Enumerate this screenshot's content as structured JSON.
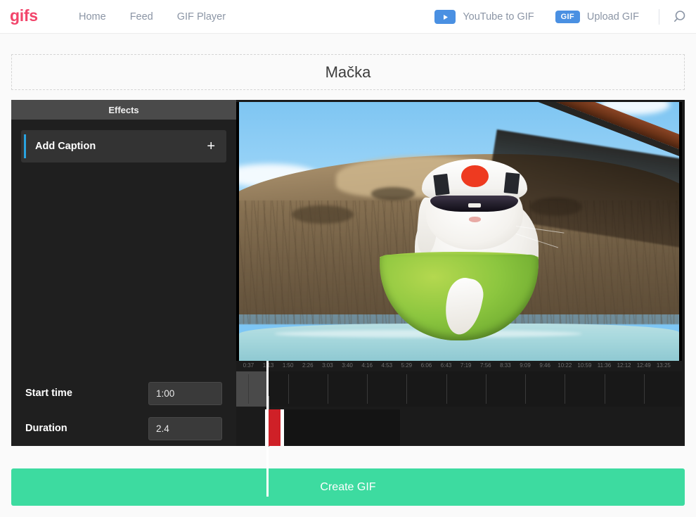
{
  "header": {
    "brand": "gifs",
    "nav": [
      {
        "label": "Home"
      },
      {
        "label": "Feed"
      },
      {
        "label": "GIF Player"
      }
    ],
    "youtube_to_gif": "YouTube to GIF",
    "gif_badge": "GIF",
    "upload_gif": "Upload GIF",
    "search_icon": "search-icon",
    "play_icon": "play-triangle-icon",
    "brand_color": "#f2456b",
    "accent_blue": "#4a90e2"
  },
  "title": {
    "text": "Mačka"
  },
  "effects": {
    "header": "Effects",
    "items": [
      {
        "label": "Add Caption",
        "add_icon": "plus-icon",
        "accent_color": "#29a3e0"
      }
    ]
  },
  "form": {
    "start_time": {
      "label": "Start time",
      "value": "1:00",
      "placeholder": "0:00"
    },
    "duration": {
      "label": "Duration",
      "value": "2.4",
      "placeholder": "0"
    }
  },
  "timeline": {
    "ticks": [
      "0:37",
      "1:13",
      "1:50",
      "2:26",
      "3:03",
      "3:40",
      "4:16",
      "4:53",
      "5:29",
      "6:06",
      "6:43",
      "7:19",
      "7:56",
      "8:33",
      "9:09",
      "9:46",
      "10:22",
      "10:59",
      "11:36",
      "12:12",
      "12:49",
      "13:25"
    ],
    "playhead_percent": 6.8,
    "buffered_percent": 7.0,
    "selection_start_percent": 7.2,
    "selection_end_percent": 10.0,
    "clip_start_percent": 7.2,
    "clip_end_percent": 36.8,
    "selection_color": "#cf2027",
    "playhead_color": "#ffffff"
  },
  "actions": {
    "create_gif": "Create GIF",
    "create_color": "#3ddba0"
  },
  "video": {
    "description": "White cat wearing a Japanese headband cap with red sun and kanji, black sunglasses, sitting in a green bowl on a teal car hood with a hillside background"
  }
}
